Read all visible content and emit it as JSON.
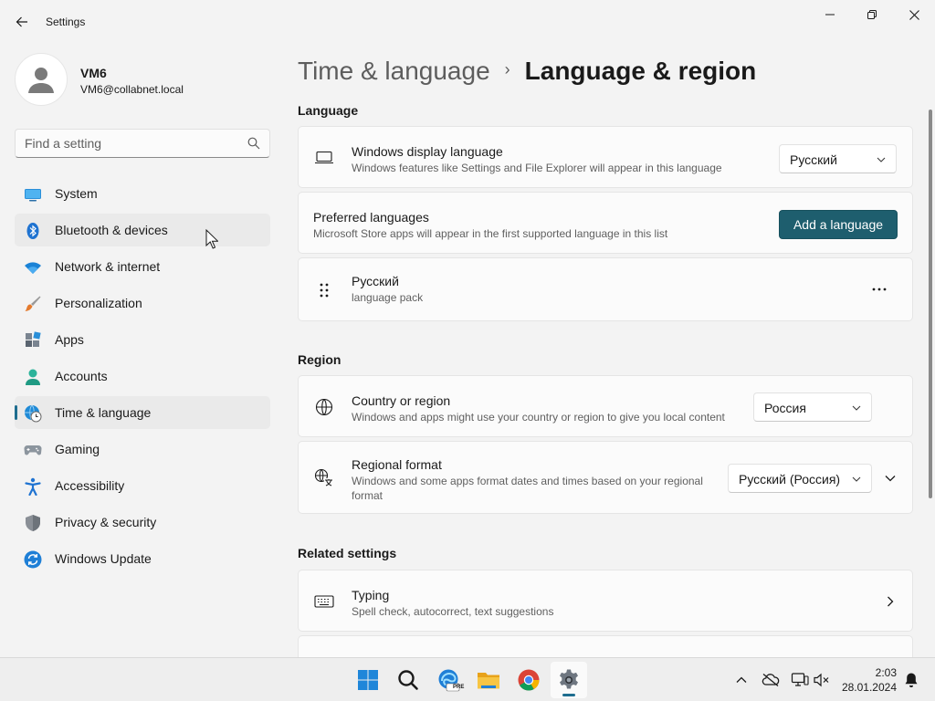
{
  "window": {
    "app_title": "Settings"
  },
  "profile": {
    "name": "VM6",
    "email": "VM6@collabnet.local"
  },
  "search": {
    "placeholder": "Find a setting"
  },
  "sidebar": {
    "items": [
      {
        "label": "System",
        "icon": "system-icon"
      },
      {
        "label": "Bluetooth & devices",
        "icon": "bluetooth-icon"
      },
      {
        "label": "Network & internet",
        "icon": "wifi-icon"
      },
      {
        "label": "Personalization",
        "icon": "brush-icon"
      },
      {
        "label": "Apps",
        "icon": "apps-icon"
      },
      {
        "label": "Accounts",
        "icon": "accounts-icon"
      },
      {
        "label": "Time & language",
        "icon": "time-language-icon"
      },
      {
        "label": "Gaming",
        "icon": "gamepad-icon"
      },
      {
        "label": "Accessibility",
        "icon": "accessibility-icon"
      },
      {
        "label": "Privacy & security",
        "icon": "shield-icon"
      },
      {
        "label": "Windows Update",
        "icon": "update-icon"
      }
    ],
    "active_index": 6,
    "hover_index": 1
  },
  "breadcrumb": {
    "parent": "Time & language",
    "separator": "›",
    "current": "Language & region"
  },
  "language_section": {
    "title": "Language",
    "display_language": {
      "title": "Windows display language",
      "subtitle": "Windows features like Settings and File Explorer will appear in this language",
      "value": "Русский"
    },
    "preferred": {
      "title": "Preferred languages",
      "subtitle": "Microsoft Store apps will appear in the first supported language in this list",
      "button": "Add a language"
    },
    "language_item": {
      "title": "Русский",
      "subtitle": "language pack"
    }
  },
  "region_section": {
    "title": "Region",
    "country": {
      "title": "Country or region",
      "subtitle": "Windows and apps might use your country or region to give you local content",
      "value": "Россия"
    },
    "format": {
      "title": "Regional format",
      "subtitle": "Windows and some apps format dates and times based on your regional format",
      "value": "Русский (Россия)"
    }
  },
  "related_section": {
    "title": "Related settings",
    "typing": {
      "title": "Typing",
      "subtitle": "Spell check, autocorrect, text suggestions"
    }
  },
  "taskbar": {
    "time": "2:03",
    "date": "28.01.2024",
    "edge_badge": "PRE"
  },
  "colors": {
    "accent": "#1e5e6e",
    "indicator": "#1e6d8f"
  }
}
